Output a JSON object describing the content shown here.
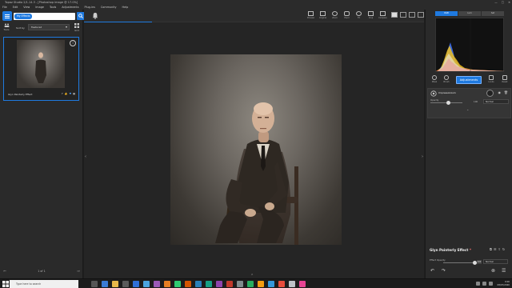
{
  "window": {
    "title": "Topaz Studio 2/1.14.3 - [Photoshop image @ 17.0%]"
  },
  "menu": [
    "File",
    "Edit",
    "View",
    "Image",
    "Tools",
    "Adjustments",
    "Plug-ins",
    "Community",
    "Help"
  ],
  "left_panel": {
    "search_chip": "My Effects",
    "sort_label": "Sort by",
    "sort_value": "Featured",
    "grid_label": "Tools",
    "tiles_label": "Grid",
    "effect_name": "Glyn Painterly Effect",
    "effect_likes": "7",
    "pager": "1 of 1"
  },
  "toolbar": {
    "tools": [
      "Preview",
      "Original",
      "Zoom",
      "Hand",
      "Fit",
      "Crop",
      "Compare"
    ],
    "progress": 0.2
  },
  "right_panel": {
    "tabs": [
      "RGB",
      "Lum",
      "Sat"
    ],
    "tools": [
      "Mask",
      "Brush",
      "Looks",
      "Reset"
    ],
    "adjustments_label": "Adjustments",
    "layer_name": "Impressionism",
    "layer_label": "Opacity",
    "layer_strength": "100",
    "layer_blend": "Normal",
    "effect_title": "Glyn Painterly Effect",
    "effect_modified": "*",
    "opacity_label": "Effect Opacity",
    "opacity_value": "100",
    "opacity_fraction": 1.0,
    "blend_mode": "Normal"
  },
  "taskbar": {
    "search_placeholder": "Type here to search",
    "time": "9:00",
    "date": "08/07/2020"
  }
}
